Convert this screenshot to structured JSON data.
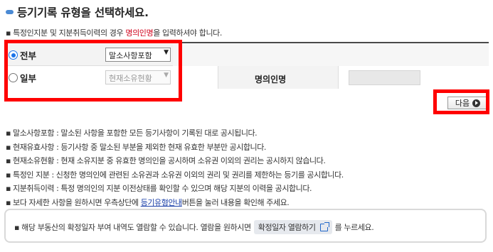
{
  "header": {
    "title": "등기기록 유형을 선택하세요."
  },
  "notice_top": {
    "prefix": "▪ 특정인지분 및 지분취득이력의 경우 ",
    "highlight": "명의인명",
    "suffix": "을 입력하셔야 합니다."
  },
  "form": {
    "row_all": {
      "label": "전부",
      "selected": true,
      "select_value": "말소사항포함"
    },
    "row_part": {
      "label": "일부",
      "selected": false,
      "select_value": "현재소유현황",
      "name_label": "명의인명",
      "name_value": ""
    }
  },
  "next_button": {
    "label": "다음"
  },
  "descriptions": [
    {
      "text": "▪ 말소사항포함 : 말소된 사항을 포함한 모든 등기사항이 기록된 대로 공시됩니다."
    },
    {
      "text": "▪ 현재유효사항 : 등기사항 중 말소된 부분을 제외한 현재 유효한 부분만 공시합니다."
    },
    {
      "text": "▪ 현재소유현황 : 현재 소유지분 중 유효한 명의인을 공시하며 소유권 이외의 권리는 공시하지 않습니다."
    },
    {
      "text": "▪ 특정인 지분 : 신청한 명의인에 관련된 소유권과 소유권 이외의 권리 및 권리를 제한하는 등기를 공시합니다."
    },
    {
      "text": "▪ 지분취득이력 : 특정 명의인의 지분 이전상태를 확인할 수 있으며 해당 지분의 이력을 공시합니다."
    }
  ],
  "last_description": {
    "prefix": "▪ 보다 자세한 사항을 원하시면 우측상단에 ",
    "link": "등기유형안내",
    "suffix": "버튼을 눌러 내용을 확인해 주세요."
  },
  "info_box": {
    "prefix": "▪  해당 부동산의 확정일자 부여 내역도 열람할 수 있습니다. 열람을 원하시면",
    "button_label": "확정일자 열람하기",
    "suffix": "를 누르세요."
  }
}
